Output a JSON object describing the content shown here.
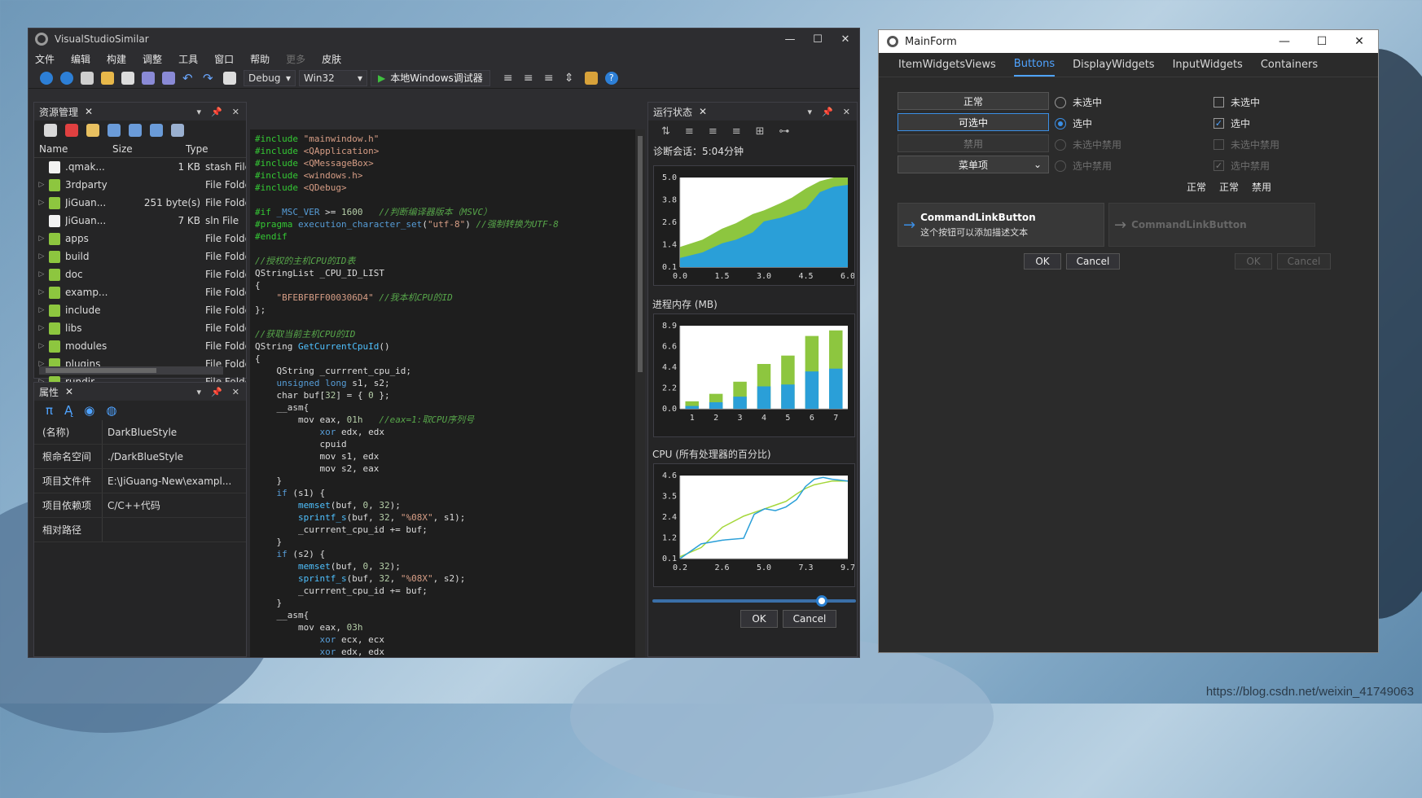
{
  "vs": {
    "title": "VisualStudioSimilar",
    "menu": [
      "文件",
      "编辑",
      "构建",
      "调整",
      "工具",
      "窗口",
      "帮助",
      "更多",
      "皮肤"
    ],
    "config": "Debug",
    "platform": "Win32",
    "run_label": "本地Windows调试器",
    "explorer": {
      "title": "资源管理",
      "col_name": "Name",
      "col_size": "Size",
      "col_type": "Type",
      "rows": [
        {
          "name": ".qmak...",
          "size": "1 KB",
          "type": "stash File",
          "icon": "file-icon"
        },
        {
          "name": "3rdparty",
          "size": "",
          "type": "File Folde",
          "icon": "folder-icon"
        },
        {
          "name": "JiGuan...",
          "size": "251 byte(s)",
          "type": "File Folde",
          "icon": "folder-icon"
        },
        {
          "name": "JiGuan...",
          "size": "7 KB",
          "type": "sln File",
          "icon": "file-icon"
        },
        {
          "name": "apps",
          "size": "",
          "type": "File Folde",
          "icon": "folder-icon"
        },
        {
          "name": "build",
          "size": "",
          "type": "File Folde",
          "icon": "folder-icon"
        },
        {
          "name": "doc",
          "size": "",
          "type": "File Folde",
          "icon": "folder-icon"
        },
        {
          "name": "examp...",
          "size": "",
          "type": "File Folde",
          "icon": "folder-icon"
        },
        {
          "name": "include",
          "size": "",
          "type": "File Folde",
          "icon": "folder-icon"
        },
        {
          "name": "libs",
          "size": "",
          "type": "File Folde",
          "icon": "folder-icon"
        },
        {
          "name": "modules",
          "size": "",
          "type": "File Folde",
          "icon": "folder-icon"
        },
        {
          "name": "plugins",
          "size": "",
          "type": "File Folde",
          "icon": "folder-icon"
        },
        {
          "name": "rundir",
          "size": "",
          "type": "File Folde",
          "icon": "folder-icon"
        }
      ]
    },
    "props": {
      "title": "属性",
      "rows": [
        {
          "k": "(名称)",
          "v": "DarkBlueStyle"
        },
        {
          "k": "根命名空间",
          "v": "./DarkBlueStyle"
        },
        {
          "k": "项目文件件",
          "v": "E:\\JiGuang-New\\exampl..."
        },
        {
          "k": "项目依赖项",
          "v": "C/C++代码"
        },
        {
          "k": "相对路径",
          "v": ""
        }
      ]
    },
    "runtime": {
      "title": "运行状态",
      "session": "诊断会话：5:04分钟",
      "mem_title": "进程内存 (MB)",
      "cpu_title": "CPU (所有处理器的百分比)",
      "ok": "OK",
      "cancel": "Cancel",
      "slider_value": 0.83
    }
  },
  "chart_data": [
    {
      "type": "area",
      "x": [
        0,
        0.8,
        1.5,
        2,
        2.6,
        3,
        3.6,
        4,
        4.5,
        5,
        5.5,
        6
      ],
      "series": [
        {
          "values": [
            1.2,
            1.6,
            2.2,
            2.5,
            3.0,
            3.2,
            3.6,
            3.9,
            4.4,
            4.8,
            5.0,
            5.0
          ],
          "color": "#8dc63f"
        },
        {
          "values": [
            0.6,
            0.9,
            1.4,
            1.6,
            2.0,
            2.6,
            2.8,
            3.0,
            3.3,
            4.2,
            4.5,
            4.6
          ],
          "color": "#2a9fd8"
        }
      ],
      "xticks": [
        "0.0",
        "1.5",
        "3.0",
        "4.5",
        "6.0"
      ],
      "yticks": [
        "0.1",
        "1.4",
        "2.6",
        "3.8",
        "5.0"
      ],
      "ylim": [
        0.1,
        5.0
      ],
      "xlim": [
        0,
        6
      ]
    },
    {
      "type": "bar",
      "categories": [
        "1",
        "2",
        "3",
        "4",
        "5",
        "6",
        "7"
      ],
      "series": [
        {
          "values": [
            0.8,
            1.6,
            2.9,
            4.8,
            5.7,
            7.8,
            8.4
          ],
          "color": "#8dc63f"
        },
        {
          "values": [
            0.3,
            0.7,
            1.3,
            2.4,
            2.6,
            4.0,
            4.3
          ],
          "color": "#2a9fd8"
        }
      ],
      "yticks": [
        "0.0",
        "2.2",
        "4.4",
        "6.6",
        "8.9"
      ],
      "ylim": [
        0,
        8.9
      ]
    },
    {
      "type": "line",
      "x": [
        0.2,
        1.4,
        2.6,
        3.8,
        4.4,
        5.0,
        5.6,
        6.2,
        6.8,
        7.3,
        7.8,
        8.3,
        8.8,
        9.7
      ],
      "series": [
        {
          "values": [
            0.2,
            0.7,
            1.8,
            2.4,
            2.6,
            2.8,
            3.0,
            3.2,
            3.6,
            3.9,
            4.1,
            4.2,
            4.3,
            4.3
          ],
          "color": "#a5d73a"
        },
        {
          "values": [
            0.1,
            0.9,
            1.1,
            1.2,
            2.5,
            2.8,
            2.7,
            2.9,
            3.3,
            4.0,
            4.4,
            4.5,
            4.4,
            4.3
          ],
          "color": "#2a9fd8"
        }
      ],
      "xticks": [
        "0.2",
        "2.6",
        "5.0",
        "7.3",
        "9.7"
      ],
      "yticks": [
        "0.1",
        "1.2",
        "2.4",
        "3.5",
        "4.6"
      ],
      "ylim": [
        0.1,
        4.6
      ],
      "xlim": [
        0.2,
        9.7
      ]
    }
  ],
  "mainform": {
    "title": "MainForm",
    "tabs": [
      "ItemWidgetsViews",
      "Buttons",
      "DisplayWidgets",
      "InputWidgets",
      "Containers"
    ],
    "active_tab": "Buttons",
    "push": [
      "正常",
      "可选中",
      "禁用",
      "菜单项"
    ],
    "radios": [
      "未选中",
      "选中",
      "未选中禁用",
      "选中禁用"
    ],
    "checks": [
      "未选中",
      "选中",
      "未选中禁用",
      "选中禁用"
    ],
    "tool": [
      "正常",
      "正常",
      "禁用"
    ],
    "cmd_title": "CommandLinkButton",
    "cmd_desc": "这个按钮可以添加描述文本",
    "cmd_title2": "CommandLinkButton",
    "ok": "OK",
    "cancel": "Cancel"
  },
  "watermark": "https://blog.csdn.net/weixin_41749063"
}
